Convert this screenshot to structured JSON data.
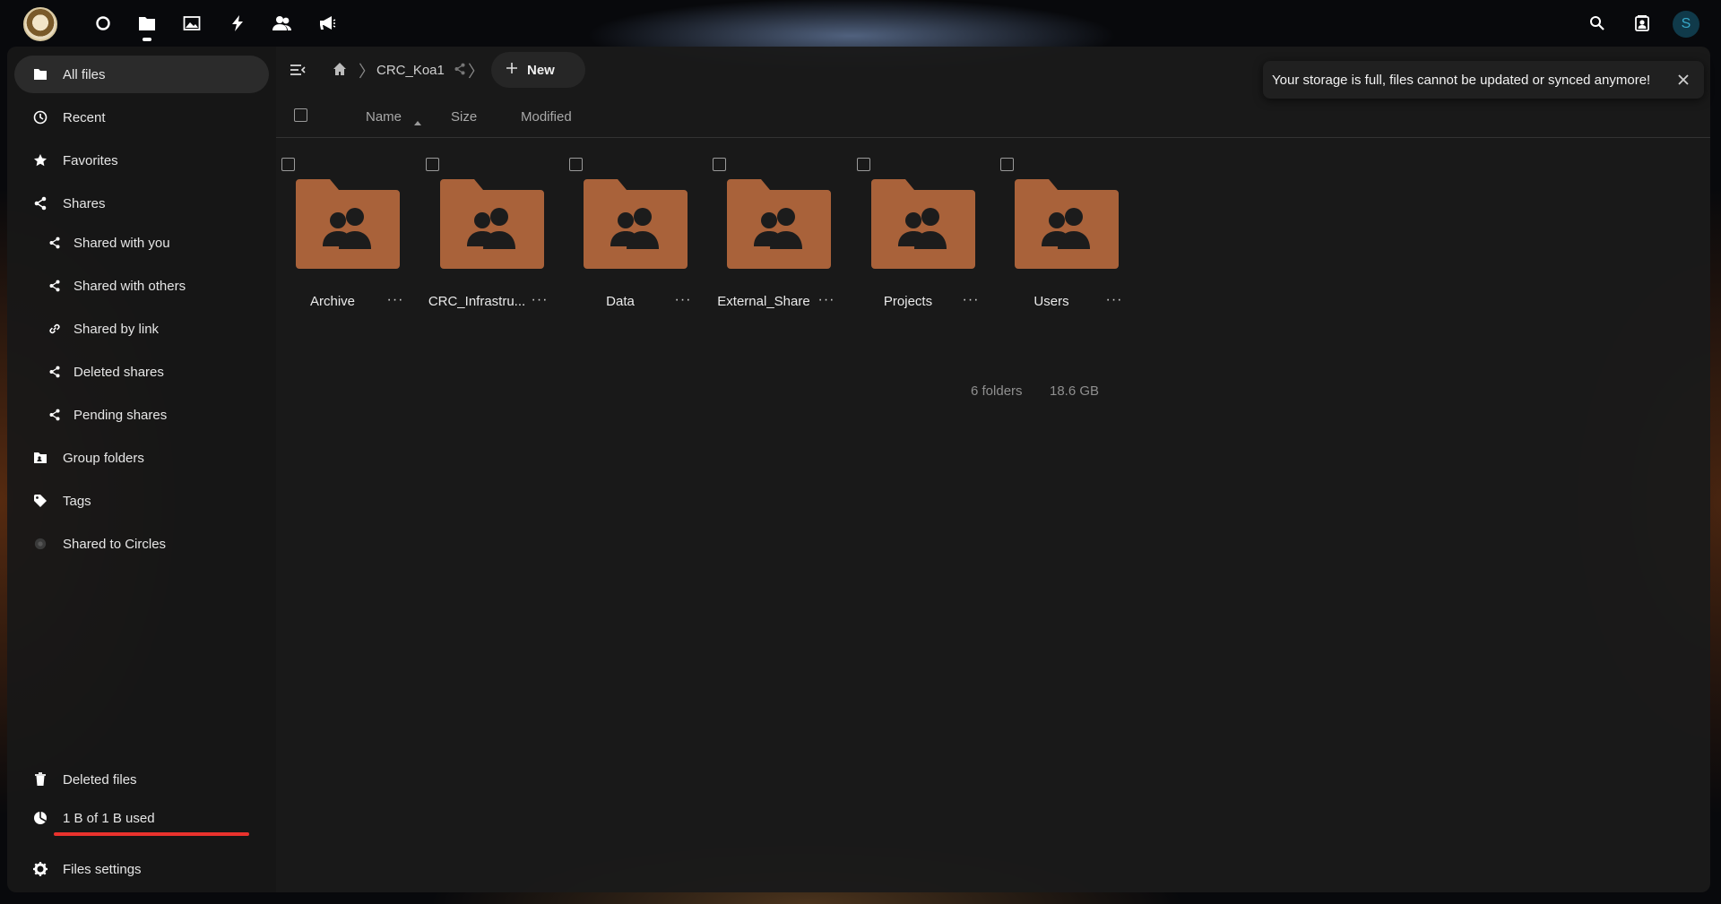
{
  "header": {
    "apps": [
      {
        "name": "dashboard",
        "icon": "circle-icon"
      },
      {
        "name": "files",
        "icon": "folder-icon",
        "active": true
      },
      {
        "name": "photos",
        "icon": "image-icon"
      },
      {
        "name": "activity",
        "icon": "lightning-icon"
      },
      {
        "name": "contacts",
        "icon": "people-icon"
      },
      {
        "name": "announcements",
        "icon": "megaphone-icon"
      }
    ],
    "avatar_initial": "S"
  },
  "sidebar": {
    "items": [
      {
        "label": "All files",
        "icon": "folder-icon",
        "active": true
      },
      {
        "label": "Recent",
        "icon": "clock-icon"
      },
      {
        "label": "Favorites",
        "icon": "star-icon"
      },
      {
        "label": "Shares",
        "icon": "share-icon"
      },
      {
        "label": "Shared with you",
        "icon": "share-icon",
        "sub": true
      },
      {
        "label": "Shared with others",
        "icon": "share-icon",
        "sub": true
      },
      {
        "label": "Shared by link",
        "icon": "link-icon",
        "sub": true
      },
      {
        "label": "Deleted shares",
        "icon": "share-icon",
        "sub": true
      },
      {
        "label": "Pending shares",
        "icon": "share-icon",
        "sub": true
      },
      {
        "label": "Group folders",
        "icon": "group-folder-icon"
      },
      {
        "label": "Tags",
        "icon": "tag-icon"
      },
      {
        "label": "Shared to Circles",
        "icon": "circles-icon"
      }
    ],
    "deleted_files": "Deleted files",
    "quota": {
      "label": "1 B of 1 B used",
      "fraction": 1.0,
      "color": "#e9322d"
    },
    "settings": "Files settings"
  },
  "toolbar": {
    "breadcrumb": "CRC_Koa1",
    "new_label": "New"
  },
  "list_header": {
    "name": "Name",
    "size": "Size",
    "modified": "Modified"
  },
  "folders": [
    {
      "name": "Archive"
    },
    {
      "name": "CRC_Infrastru..."
    },
    {
      "name": "Data"
    },
    {
      "name": "External_Share"
    },
    {
      "name": "Projects"
    },
    {
      "name": "Users"
    }
  ],
  "summary": {
    "count": "6 folders",
    "size": "18.6 GB"
  },
  "toast": {
    "message": "Your storage is full, files cannot be updated or synced anymore!"
  },
  "colors": {
    "folder": "#a9623a",
    "accent": "#e9322d"
  }
}
